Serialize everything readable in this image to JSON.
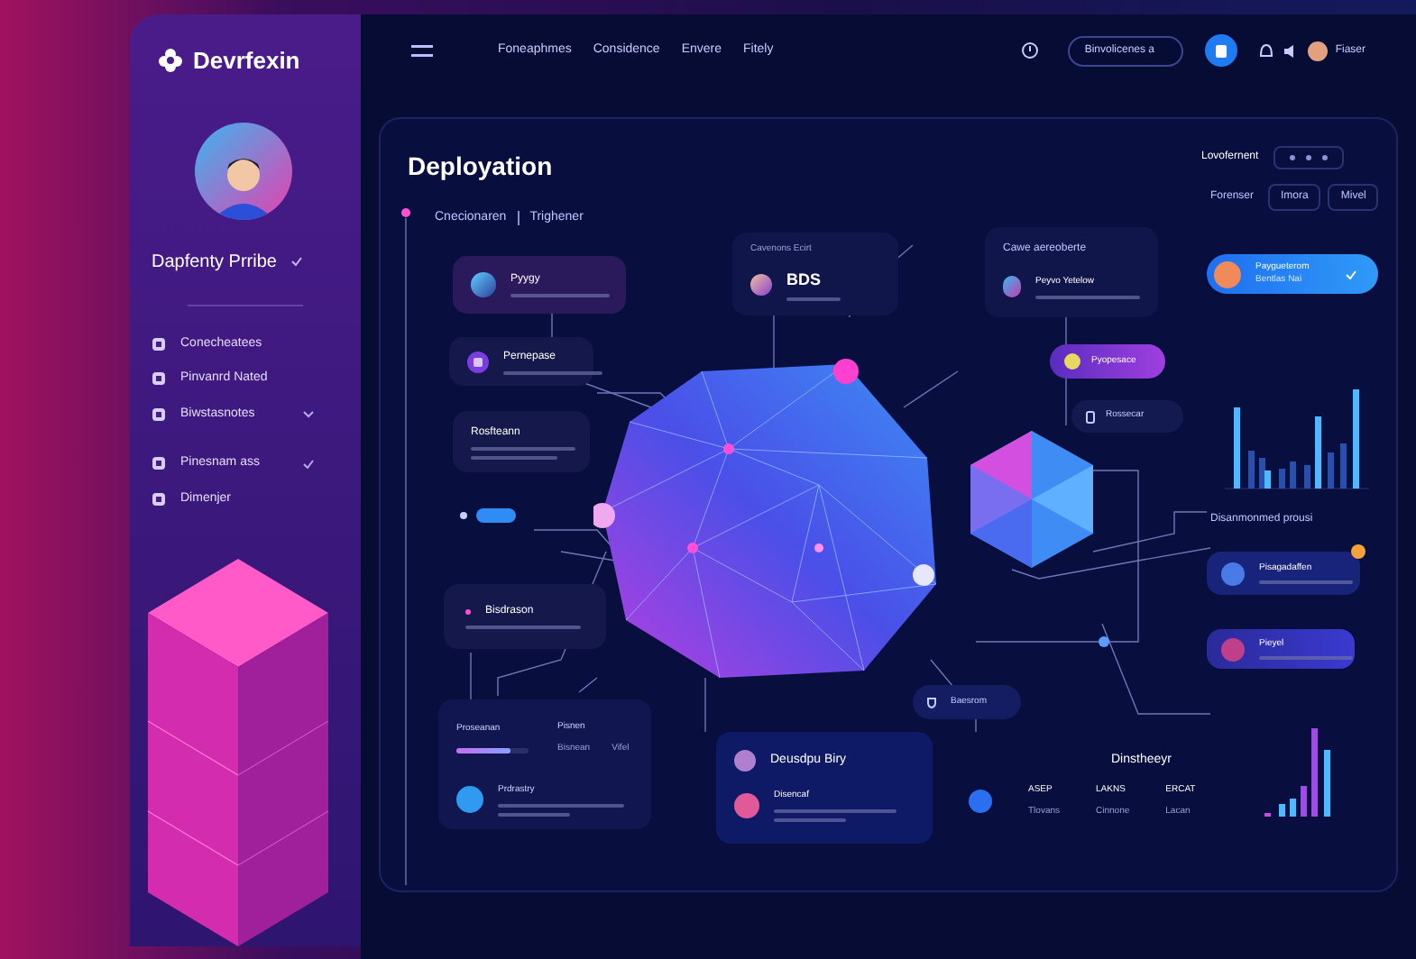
{
  "sidebar": {
    "logo": "Devrfexin",
    "profile_name": "Dapfenty Prribe",
    "items": [
      {
        "label": "Conecheatees",
        "kind": "plain"
      },
      {
        "label": "Pinvanrd Nated",
        "kind": "plain"
      },
      {
        "label": "Biwstasnotes",
        "kind": "chevron"
      },
      {
        "label": "Pinesnam ass",
        "kind": "check"
      },
      {
        "label": "Dimenjer",
        "kind": "plain"
      }
    ]
  },
  "top_bar": {
    "nav": [
      "Foneaphmes",
      "Considence",
      "Envere",
      "Fitely"
    ],
    "search": {
      "value": "Binvolicenes a"
    },
    "user": "Fiaser"
  },
  "main": {
    "title": "Deployation",
    "breadcrumb": [
      "Cnecionaren",
      "Trighener"
    ],
    "environment_label": "Lovofernent",
    "filter_label": "Forenser",
    "filters": [
      "Imora",
      "Mivel"
    ],
    "left_cards": [
      {
        "title": "Pyygy",
        "kind": "avatar"
      },
      {
        "title": "Pernepase",
        "kind": "icon"
      },
      {
        "title": "Rosfteann",
        "kind": "text"
      }
    ],
    "toggle": {
      "on": true
    },
    "bottom_left_note": {
      "title": "Bisdrason"
    },
    "metric_card": {
      "caption": "Cavenons Ecirt",
      "value": "BDS"
    },
    "header_card": {
      "caption": "Cawe aereoberte",
      "title": "Peyvo Yetelow"
    },
    "magenta_pill": "Pyopesace",
    "dark_pill": "Rossecar",
    "status_pill": {
      "title": "Paygueterom",
      "subtitle": "Bentlas Nai"
    },
    "section_label": "Disanmonmed prousi",
    "right_cards": [
      "Pisagadaffen",
      "Pieyel"
    ],
    "progress_card": {
      "title": "Proseanan",
      "col_a": "Pisnen",
      "col_b": "Bisnean",
      "col_c": "Vifel",
      "level": 0.75,
      "person": "Prdrastry"
    },
    "small_pill": "Baesrom",
    "activity_card": {
      "title": "Deusdpu Biry",
      "entry": "Disencaf"
    },
    "stats_title": "Dinstheeyr",
    "stats": [
      {
        "label": "ASEP",
        "value": "Tlovans"
      },
      {
        "label": "LAKNS",
        "value": "Cinnone"
      },
      {
        "label": "ERCAT",
        "value": "Lacan"
      }
    ]
  }
}
